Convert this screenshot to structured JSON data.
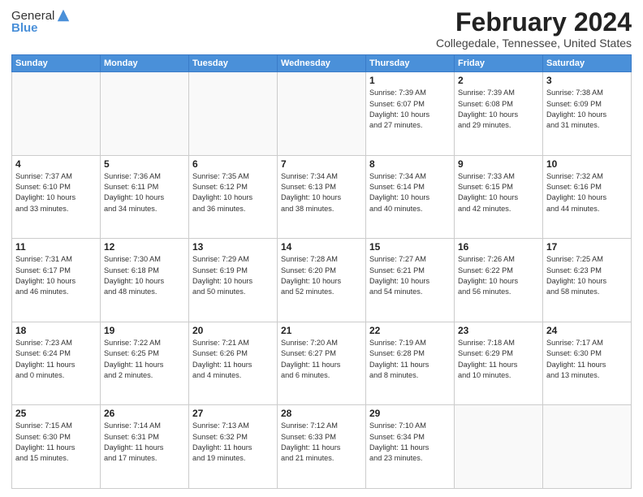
{
  "header": {
    "logo_general": "General",
    "logo_blue": "Blue",
    "title": "February 2024",
    "location": "Collegedale, Tennessee, United States"
  },
  "weekdays": [
    "Sunday",
    "Monday",
    "Tuesday",
    "Wednesday",
    "Thursday",
    "Friday",
    "Saturday"
  ],
  "weeks": [
    [
      {
        "day": "",
        "info": ""
      },
      {
        "day": "",
        "info": ""
      },
      {
        "day": "",
        "info": ""
      },
      {
        "day": "",
        "info": ""
      },
      {
        "day": "1",
        "info": "Sunrise: 7:39 AM\nSunset: 6:07 PM\nDaylight: 10 hours\nand 27 minutes."
      },
      {
        "day": "2",
        "info": "Sunrise: 7:39 AM\nSunset: 6:08 PM\nDaylight: 10 hours\nand 29 minutes."
      },
      {
        "day": "3",
        "info": "Sunrise: 7:38 AM\nSunset: 6:09 PM\nDaylight: 10 hours\nand 31 minutes."
      }
    ],
    [
      {
        "day": "4",
        "info": "Sunrise: 7:37 AM\nSunset: 6:10 PM\nDaylight: 10 hours\nand 33 minutes."
      },
      {
        "day": "5",
        "info": "Sunrise: 7:36 AM\nSunset: 6:11 PM\nDaylight: 10 hours\nand 34 minutes."
      },
      {
        "day": "6",
        "info": "Sunrise: 7:35 AM\nSunset: 6:12 PM\nDaylight: 10 hours\nand 36 minutes."
      },
      {
        "day": "7",
        "info": "Sunrise: 7:34 AM\nSunset: 6:13 PM\nDaylight: 10 hours\nand 38 minutes."
      },
      {
        "day": "8",
        "info": "Sunrise: 7:34 AM\nSunset: 6:14 PM\nDaylight: 10 hours\nand 40 minutes."
      },
      {
        "day": "9",
        "info": "Sunrise: 7:33 AM\nSunset: 6:15 PM\nDaylight: 10 hours\nand 42 minutes."
      },
      {
        "day": "10",
        "info": "Sunrise: 7:32 AM\nSunset: 6:16 PM\nDaylight: 10 hours\nand 44 minutes."
      }
    ],
    [
      {
        "day": "11",
        "info": "Sunrise: 7:31 AM\nSunset: 6:17 PM\nDaylight: 10 hours\nand 46 minutes."
      },
      {
        "day": "12",
        "info": "Sunrise: 7:30 AM\nSunset: 6:18 PM\nDaylight: 10 hours\nand 48 minutes."
      },
      {
        "day": "13",
        "info": "Sunrise: 7:29 AM\nSunset: 6:19 PM\nDaylight: 10 hours\nand 50 minutes."
      },
      {
        "day": "14",
        "info": "Sunrise: 7:28 AM\nSunset: 6:20 PM\nDaylight: 10 hours\nand 52 minutes."
      },
      {
        "day": "15",
        "info": "Sunrise: 7:27 AM\nSunset: 6:21 PM\nDaylight: 10 hours\nand 54 minutes."
      },
      {
        "day": "16",
        "info": "Sunrise: 7:26 AM\nSunset: 6:22 PM\nDaylight: 10 hours\nand 56 minutes."
      },
      {
        "day": "17",
        "info": "Sunrise: 7:25 AM\nSunset: 6:23 PM\nDaylight: 10 hours\nand 58 minutes."
      }
    ],
    [
      {
        "day": "18",
        "info": "Sunrise: 7:23 AM\nSunset: 6:24 PM\nDaylight: 11 hours\nand 0 minutes."
      },
      {
        "day": "19",
        "info": "Sunrise: 7:22 AM\nSunset: 6:25 PM\nDaylight: 11 hours\nand 2 minutes."
      },
      {
        "day": "20",
        "info": "Sunrise: 7:21 AM\nSunset: 6:26 PM\nDaylight: 11 hours\nand 4 minutes."
      },
      {
        "day": "21",
        "info": "Sunrise: 7:20 AM\nSunset: 6:27 PM\nDaylight: 11 hours\nand 6 minutes."
      },
      {
        "day": "22",
        "info": "Sunrise: 7:19 AM\nSunset: 6:28 PM\nDaylight: 11 hours\nand 8 minutes."
      },
      {
        "day": "23",
        "info": "Sunrise: 7:18 AM\nSunset: 6:29 PM\nDaylight: 11 hours\nand 10 minutes."
      },
      {
        "day": "24",
        "info": "Sunrise: 7:17 AM\nSunset: 6:30 PM\nDaylight: 11 hours\nand 13 minutes."
      }
    ],
    [
      {
        "day": "25",
        "info": "Sunrise: 7:15 AM\nSunset: 6:30 PM\nDaylight: 11 hours\nand 15 minutes."
      },
      {
        "day": "26",
        "info": "Sunrise: 7:14 AM\nSunset: 6:31 PM\nDaylight: 11 hours\nand 17 minutes."
      },
      {
        "day": "27",
        "info": "Sunrise: 7:13 AM\nSunset: 6:32 PM\nDaylight: 11 hours\nand 19 minutes."
      },
      {
        "day": "28",
        "info": "Sunrise: 7:12 AM\nSunset: 6:33 PM\nDaylight: 11 hours\nand 21 minutes."
      },
      {
        "day": "29",
        "info": "Sunrise: 7:10 AM\nSunset: 6:34 PM\nDaylight: 11 hours\nand 23 minutes."
      },
      {
        "day": "",
        "info": ""
      },
      {
        "day": "",
        "info": ""
      }
    ]
  ]
}
